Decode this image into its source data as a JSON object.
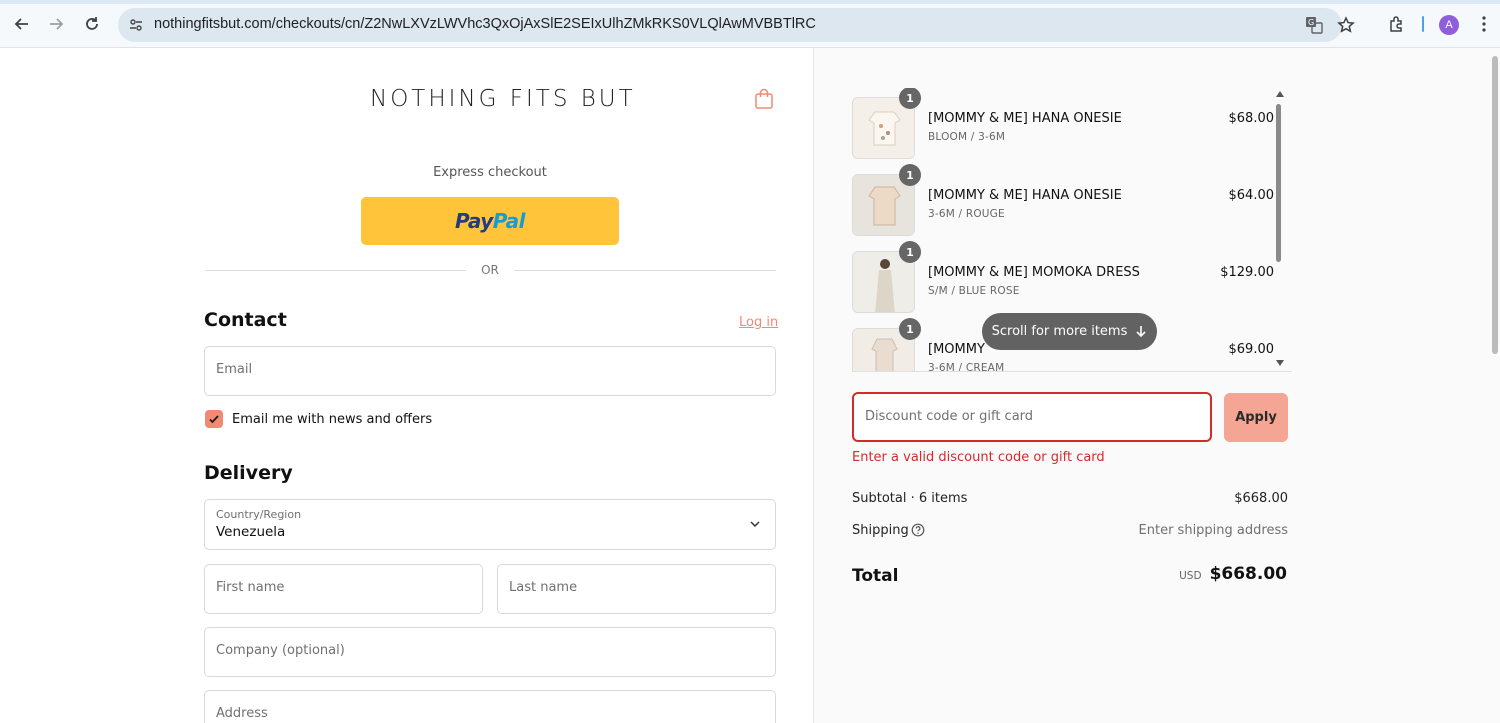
{
  "browser": {
    "url": "nothingfitsbut.com/checkouts/cn/Z2NwLXVzLWVhc3QxOjAxSlE2SEIxUlhZMkRKS0VLQlAwMVBBTlRC",
    "avatar_letter": "A",
    "icons": [
      "back-arrow-icon",
      "forward-arrow-icon",
      "reload-icon",
      "site-settings-icon",
      "translate-icon",
      "star-icon",
      "extensions-icon",
      "menu-dots-icon"
    ]
  },
  "header": {
    "brand": "NOTHING FITS BUT",
    "cart_icon": "shopping-bag-icon"
  },
  "express": {
    "label": "Express checkout",
    "paypal_part1": "Pay",
    "paypal_part2": "Pal",
    "divider": "OR"
  },
  "contact": {
    "heading": "Contact",
    "login_link": "Log in",
    "email_placeholder": "Email",
    "newsletter_label": "Email me with news and offers",
    "newsletter_checked": true
  },
  "delivery": {
    "heading": "Delivery",
    "country_label": "Country/Region",
    "country_value": "Venezuela",
    "first_name_placeholder": "First name",
    "last_name_placeholder": "Last name",
    "company_placeholder": "Company (optional)",
    "address_placeholder": "Address"
  },
  "cart": {
    "items": [
      {
        "qty": "1",
        "name": "[MOMMY & ME] HANA ONESIE",
        "variant": "BLOOM / 3-6M",
        "price": "$68.00"
      },
      {
        "qty": "1",
        "name": "[MOMMY & ME] HANA ONESIE",
        "variant": "3-6M / ROUGE",
        "price": "$64.00"
      },
      {
        "qty": "1",
        "name": "[MOMMY & ME] MOMOKA DRESS",
        "variant": "S/M / BLUE ROSE",
        "price": "$129.00"
      },
      {
        "qty": "1",
        "name": "[MOMMY",
        "variant": "3-6M / CREAM",
        "price": "$69.00"
      }
    ],
    "scroll_hint": "Scroll for more items"
  },
  "discount": {
    "placeholder": "Discount code or gift card",
    "apply_label": "Apply",
    "error": "Enter a valid discount code or gift card"
  },
  "summary": {
    "subtotal_label": "Subtotal · 6 items",
    "subtotal_value": "$668.00",
    "shipping_label": "Shipping",
    "shipping_value": "Enter shipping address",
    "total_label": "Total",
    "currency": "USD",
    "total_value": "$668.00"
  },
  "colors": {
    "accent": "#f08a73",
    "error": "#d42a2a",
    "paypal_yellow": "#ffc439",
    "apply_bg": "#f5a594"
  }
}
